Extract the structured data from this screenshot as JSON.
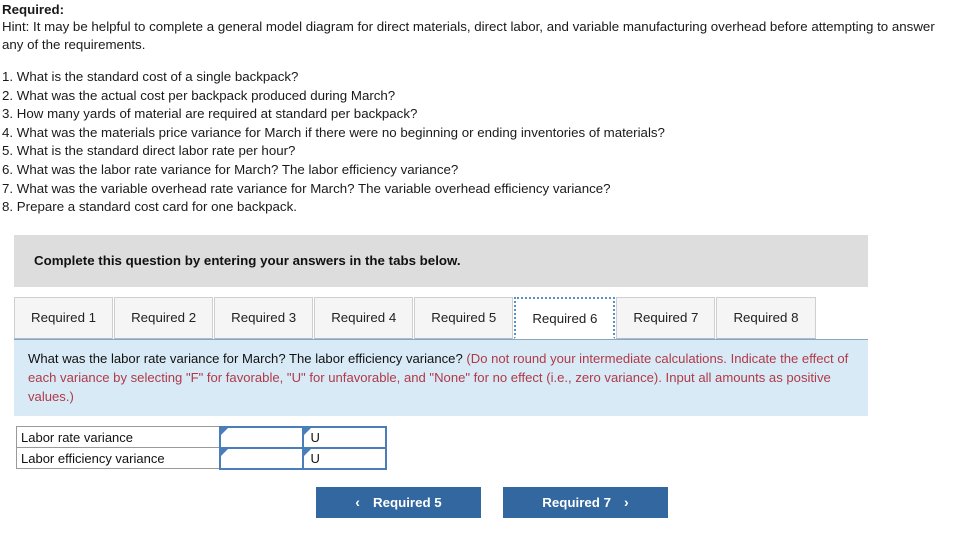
{
  "header": {
    "required_label": "Required:",
    "hint": "Hint:  It may be helpful to complete a general model diagram for direct materials, direct labor, and variable manufacturing overhead before attempting to answer any of the requirements."
  },
  "questions": [
    "1. What is the standard cost of a single backpack?",
    "2. What was the actual cost per backpack produced during March?",
    "3. How many yards of material are required at standard per backpack?",
    "4. What was the materials price variance for March if there were no beginning or ending inventories of materials?",
    "5. What is the standard direct labor rate per hour?",
    "6. What was the labor rate variance for March? The labor efficiency variance?",
    "7. What was the variable overhead rate variance for March? The variable overhead efficiency variance?",
    "8. Prepare a standard cost card for one backpack."
  ],
  "banner": {
    "text": "Complete this question by entering your answers in the tabs below."
  },
  "tabs": [
    {
      "label": "Required 1",
      "active": false
    },
    {
      "label": "Required 2",
      "active": false
    },
    {
      "label": "Required 3",
      "active": false
    },
    {
      "label": "Required 4",
      "active": false
    },
    {
      "label": "Required 5",
      "active": false
    },
    {
      "label": "Required 6",
      "active": true
    },
    {
      "label": "Required 7",
      "active": false
    },
    {
      "label": "Required 8",
      "active": false
    }
  ],
  "panel": {
    "question": "What was the labor rate variance for March? The labor efficiency variance? ",
    "note": "(Do not round your intermediate calculations. Indicate the effect of each variance by selecting \"F\" for favorable, \"U\" for unfavorable, and \"None\" for no effect (i.e., zero variance). Input all amounts as positive values.)"
  },
  "answer_table": {
    "rows": [
      {
        "label": "Labor rate variance",
        "amount": "",
        "effect": "U"
      },
      {
        "label": "Labor efficiency variance",
        "amount": "",
        "effect": "U"
      }
    ]
  },
  "nav": {
    "prev_label": "Required 5",
    "next_label": "Required 7",
    "prev_icon": "chevron-left-icon",
    "next_icon": "chevron-right-icon",
    "prev_glyph": "‹",
    "next_glyph": "›"
  },
  "colors": {
    "banner_gray": "#dddddd",
    "panel_blue": "#d9eaf7",
    "button_blue": "#32679f",
    "note_red": "#b03a48",
    "input_border_blue": "#4a7ebb"
  }
}
